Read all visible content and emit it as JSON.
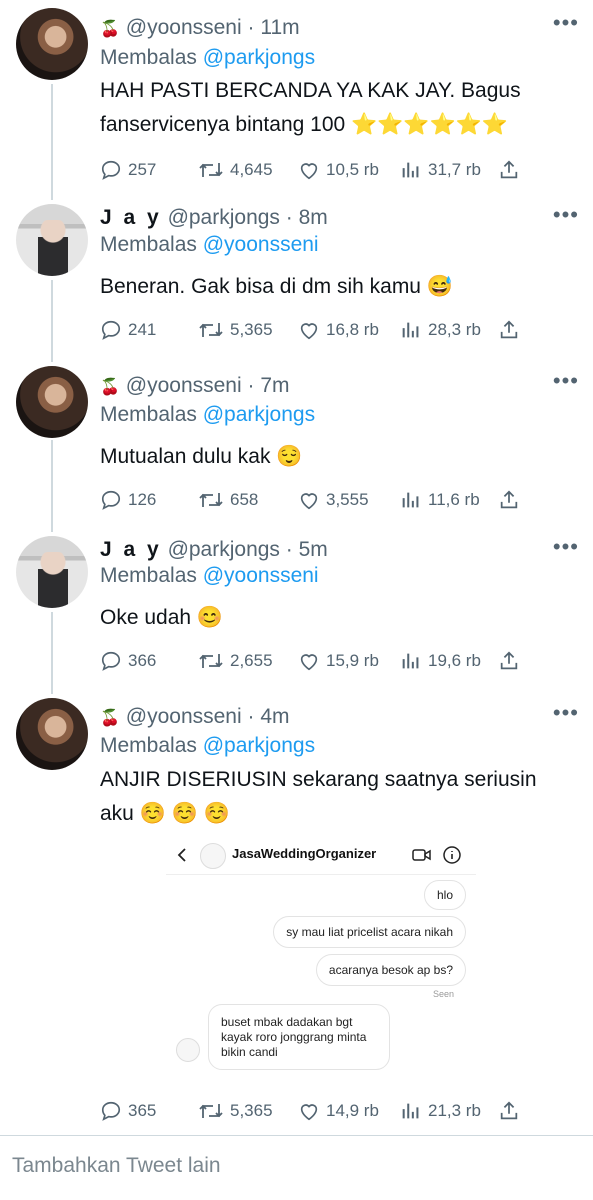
{
  "tweets": [
    {
      "handle": "@yoonsseni",
      "time": "11m",
      "reply_label": "Membalas",
      "reply_to": "@parkjongs",
      "text": "HAH PASTI BERCANDA YA KAK JAY. Bagus fanservicenya bintang 100 ⭐⭐⭐⭐⭐⭐",
      "stats": {
        "replies": "257",
        "retweets": "4,645",
        "likes": "10,5 rb",
        "views": "31,7 rb"
      }
    },
    {
      "name": "J a y",
      "handle": "@parkjongs",
      "time": "8m",
      "reply_label": "Membalas",
      "reply_to": "@yoonsseni",
      "text": "Beneran. Gak bisa di dm sih kamu 😅",
      "stats": {
        "replies": "241",
        "retweets": "5,365",
        "likes": "16,8 rb",
        "views": "28,3 rb"
      }
    },
    {
      "handle": "@yoonsseni",
      "time": "7m",
      "reply_label": "Membalas",
      "reply_to": "@parkjongs",
      "text": "Mutualan dulu kak 😌",
      "stats": {
        "replies": "126",
        "retweets": "658",
        "likes": "3,555",
        "views": "11,6 rb"
      }
    },
    {
      "name": "J a y",
      "handle": "@parkjongs",
      "time": "5m",
      "reply_label": "Membalas",
      "reply_to": "@yoonsseni",
      "text": "Oke udah 😊",
      "stats": {
        "replies": "366",
        "retweets": "2,655",
        "likes": "15,9 rb",
        "views": "19,6 rb"
      }
    },
    {
      "handle": "@yoonsseni",
      "time": "4m",
      "reply_label": "Membalas",
      "reply_to": "@parkjongs",
      "text": "ANJIR DISERIUSIN sekarang saatnya seriusin aku ☺️ ☺️ ☺️",
      "stats": {
        "replies": "365",
        "retweets": "5,365",
        "likes": "14,9 rb",
        "views": "21,3 rb"
      }
    }
  ],
  "dm": {
    "title": "JasaWeddingOrganizer",
    "messages": [
      "hlo",
      "sy mau liat pricelist acara nikah",
      "acaranya besok ap bs?"
    ],
    "seen": "Seen",
    "reply": "buset mbak dadakan bgt kayak roro jonggrang minta bikin candi"
  },
  "footer": {
    "placeholder": "Tambahkan Tweet lain"
  },
  "colors": {
    "accent": "#1d9bf0",
    "muted": "#536471",
    "thread_line": "#cfd9de"
  }
}
